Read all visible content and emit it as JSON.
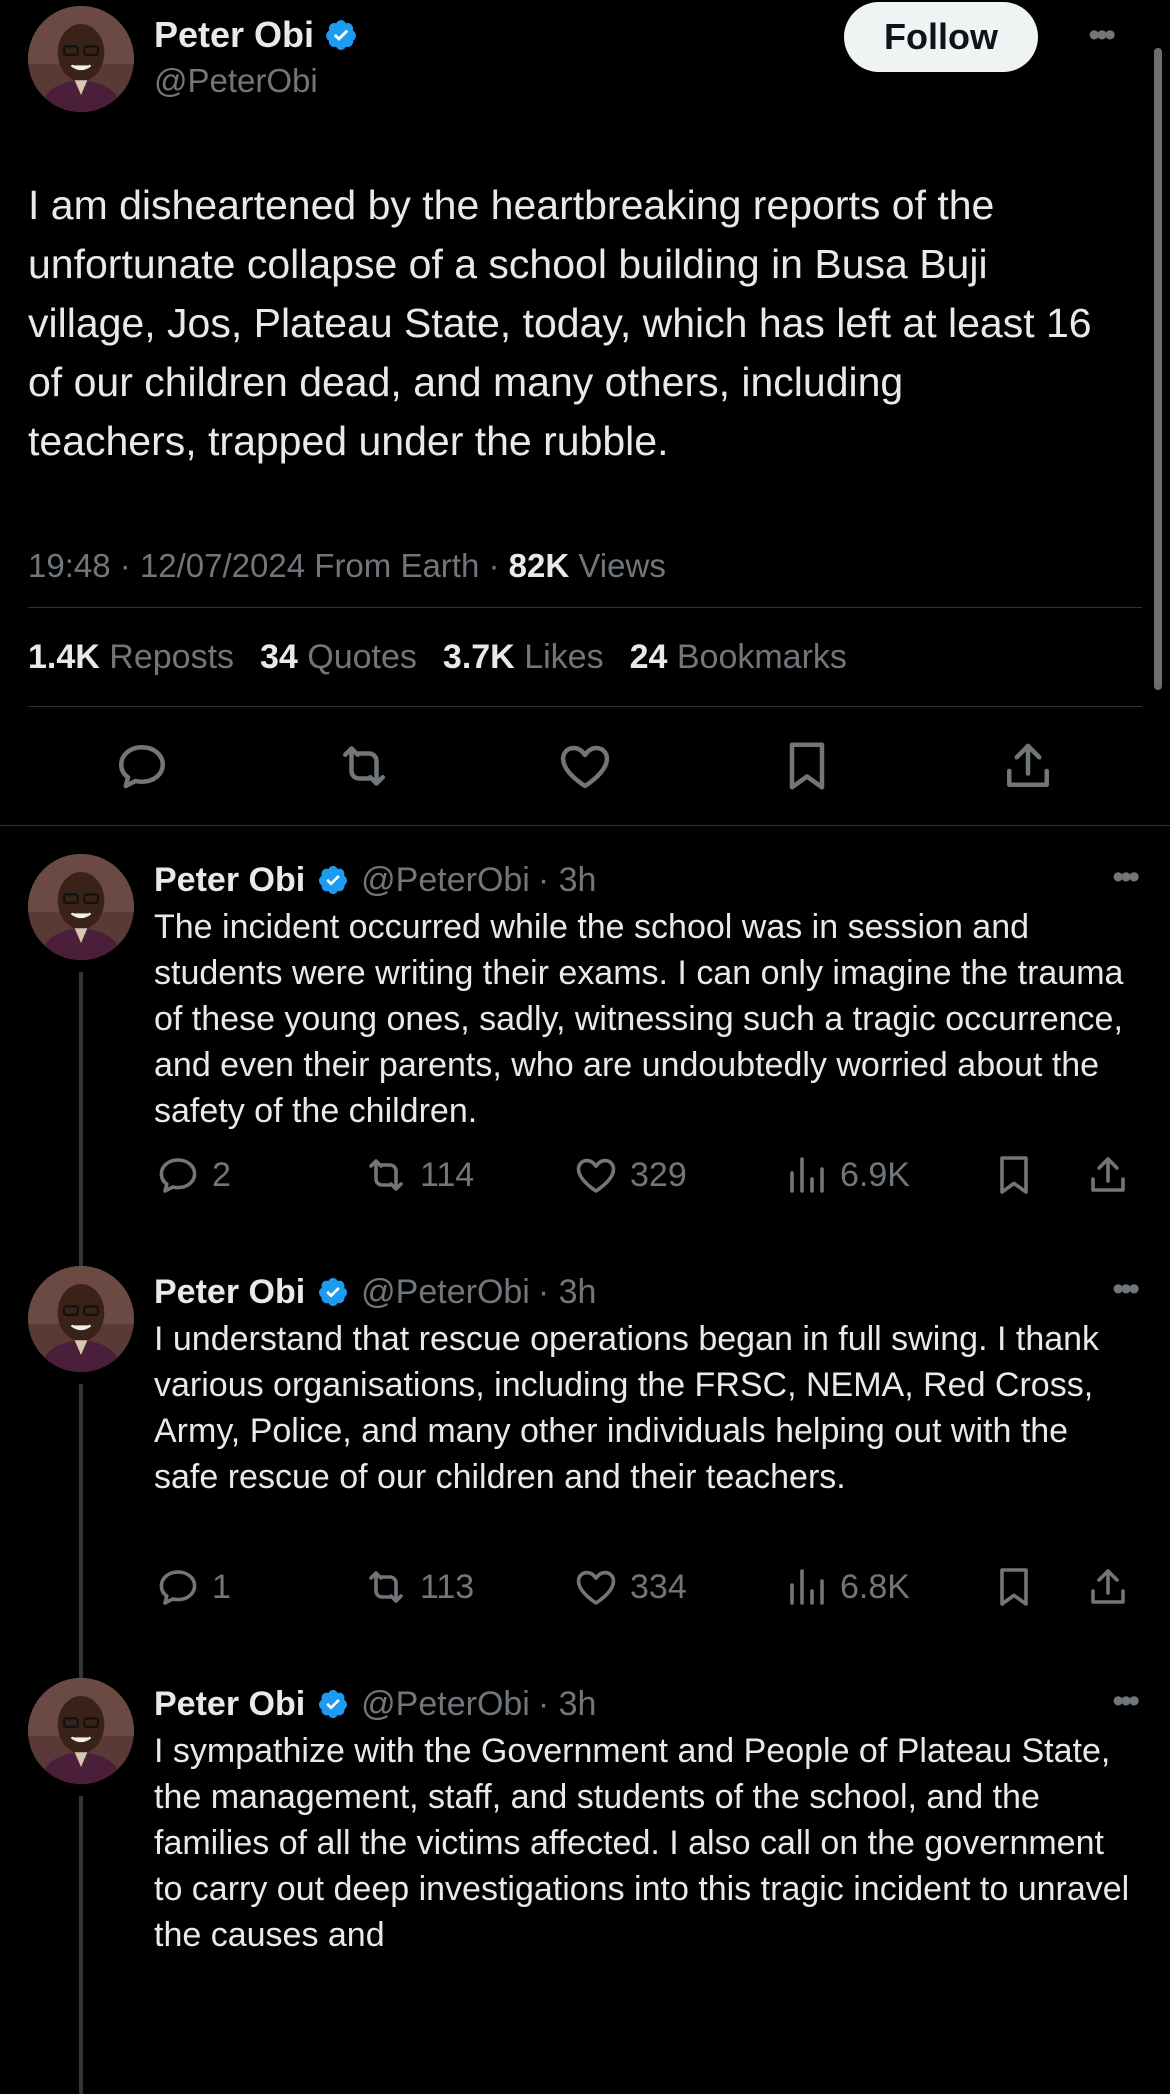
{
  "main_tweet": {
    "author_name": "Peter Obi",
    "author_handle": "@PeterObi",
    "follow_label": "Follow",
    "text": "I am disheartened by the heartbreaking reports of the\nunfortunate collapse of a school building in Busa Buji\nvillage, Jos, Plateau State, today, which has left at least 16\nof our children dead, and many others, including\nteachers, trapped under the rubble.",
    "time": "19:48",
    "date": "12/07/2024",
    "source": "From Earth",
    "views": "82K",
    "views_label": "Views",
    "stats": {
      "reposts": "1.4K",
      "reposts_label": "Reposts",
      "quotes": "34",
      "quotes_label": "Quotes",
      "likes": "3.7K",
      "likes_label": "Likes",
      "bookmarks": "24",
      "bookmarks_label": "Bookmarks"
    },
    "actions": [
      "reply-icon",
      "repost-icon",
      "like-icon",
      "bookmark-icon",
      "share-icon"
    ]
  },
  "replies": [
    {
      "author_name": "Peter Obi",
      "author_handle": "@PeterObi",
      "age": "· 3h",
      "text": "The incident occurred while the school was in session and students were writing their exams. I can only imagine the trauma of these young ones, sadly, witnessing such a tragic occurrence, and even their parents, who are undoubtedly worried about the safety of the children.",
      "replies": "2",
      "reposts": "114",
      "likes": "329",
      "views": "6.9K"
    },
    {
      "author_name": "Peter Obi",
      "author_handle": "@PeterObi",
      "age": "· 3h",
      "text": "I understand that rescue operations began in full swing. I thank various organisations, including the FRSC, NEMA, Red Cross, Army, Police, and many other individuals helping out with the safe rescue of our children and their teachers.",
      "replies": "1",
      "reposts": "113",
      "likes": "334",
      "views": "6.8K"
    },
    {
      "author_name": "Peter Obi",
      "author_handle": "@PeterObi",
      "age": "· 3h",
      "text": "I sympathize with the Government and People of Plateau State, the management, staff, and students of the school, and the families of all the victims affected. I also call on the government to carry out deep investigations into this tragic incident to unravel the causes and"
    }
  ],
  "colors": {
    "background": "#000000",
    "text": "#e7e9ea",
    "muted": "#71767b",
    "divider": "#2f3336",
    "verified": "#1d9bf0",
    "follow_bg": "#eff3f4"
  }
}
